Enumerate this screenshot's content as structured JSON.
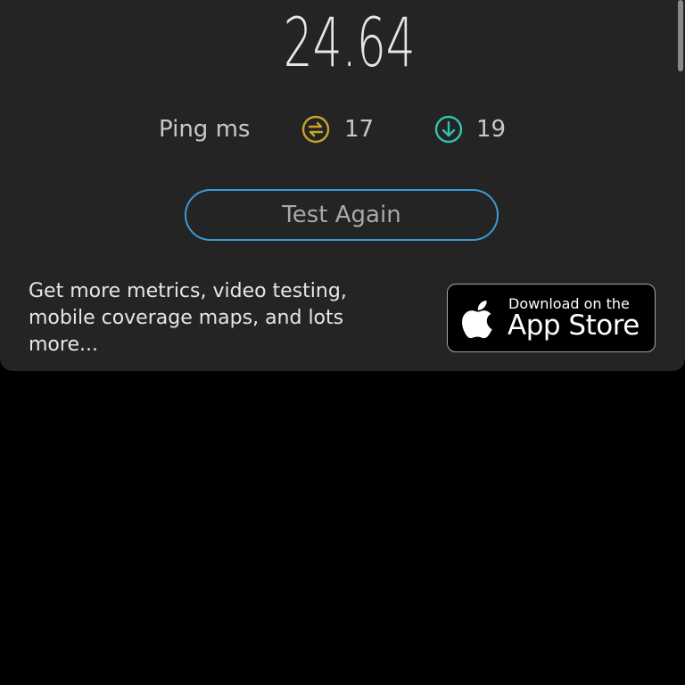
{
  "result": {
    "speed_value": "24.64"
  },
  "ping": {
    "label": "Ping ms",
    "jitter_icon": "jitter-arrows-icon",
    "jitter_value": "17",
    "jitter_color": "#c9a227",
    "download_icon": "arrow-down-circle-icon",
    "download_value": "19",
    "download_color": "#34c0b4"
  },
  "actions": {
    "test_again_label": "Test Again",
    "button_border_color": "#3b9bd6"
  },
  "promo": {
    "text": "Get more metrics, video testing, mobile coverage maps, and lots more...",
    "app_store_small": "Download on the",
    "app_store_big": "App Store",
    "app_store_icon": "apple-logo-icon"
  }
}
